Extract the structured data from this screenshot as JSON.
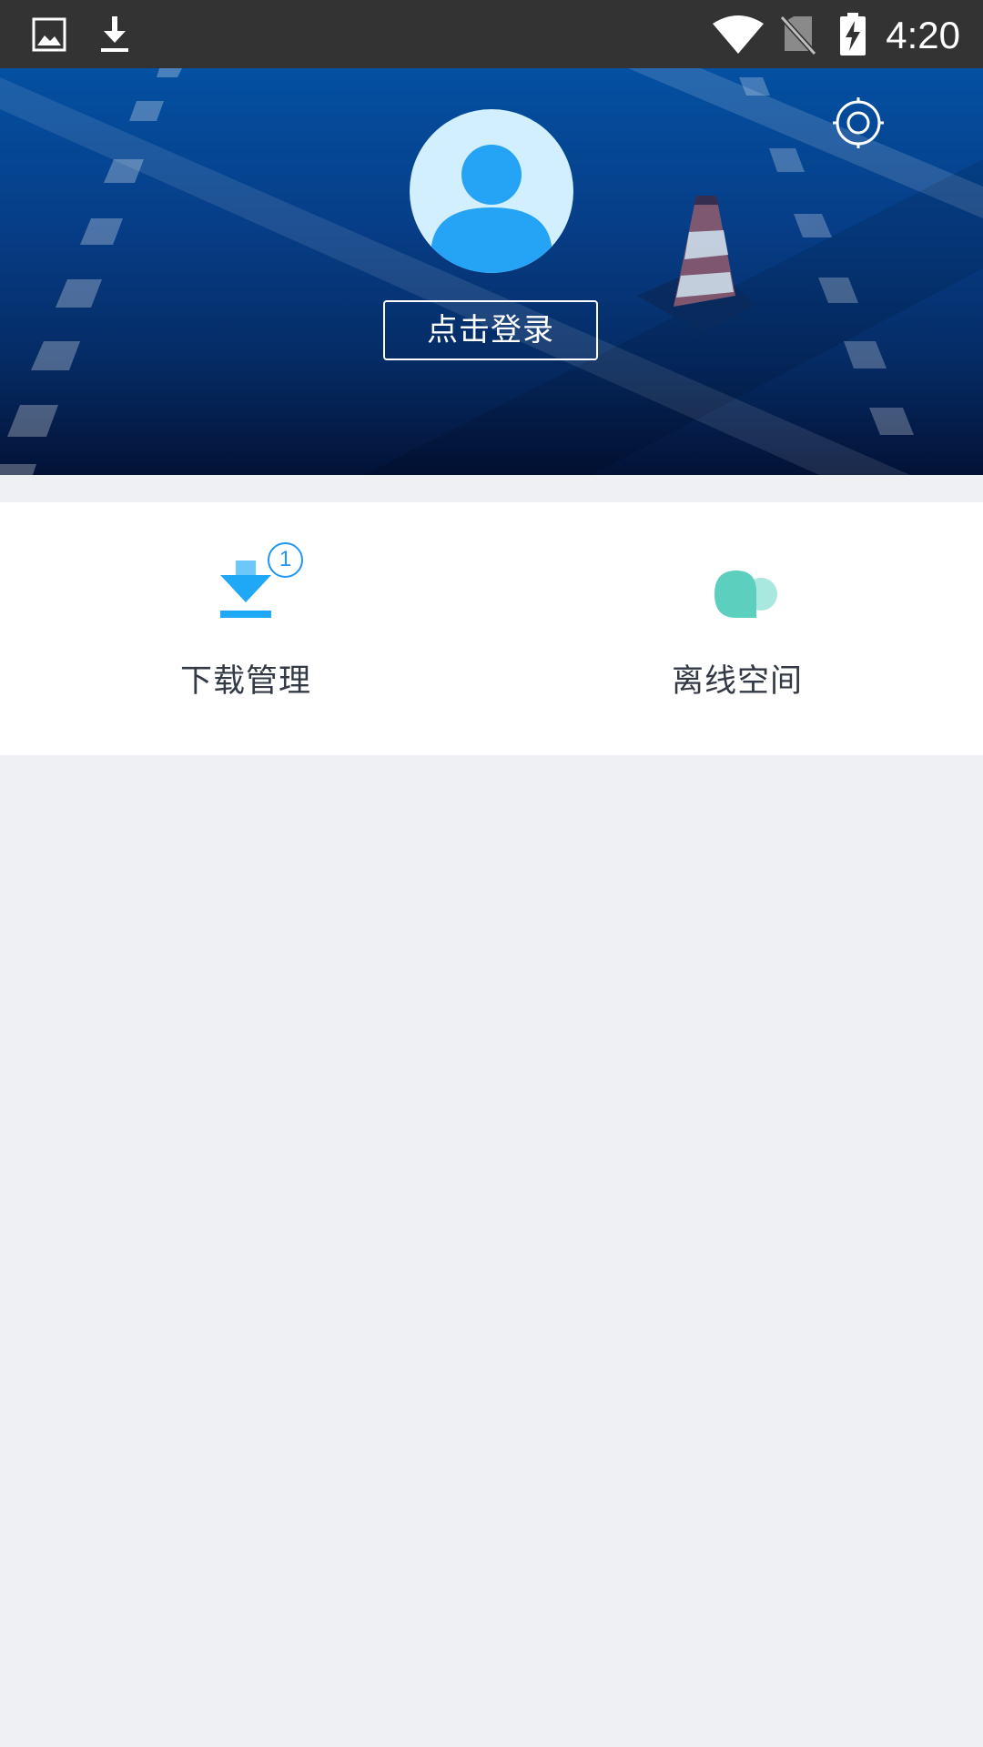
{
  "status_bar": {
    "time": "4:20",
    "left_icons": [
      "image-icon",
      "download-icon"
    ],
    "right_icons": [
      "wifi-icon",
      "no-sim-icon",
      "battery-charging-icon"
    ]
  },
  "header": {
    "login_label": "点击登录",
    "avatar_icon": "user-icon",
    "settings_icon": "settings-icon"
  },
  "menu": {
    "items": [
      {
        "label": "下载管理",
        "icon": "download-icon",
        "badge": "1",
        "color": "#1fa8f5"
      },
      {
        "label": "离线空间",
        "icon": "cloud-icon",
        "color": "#5ccfbe"
      }
    ]
  },
  "colors": {
    "header_top": "#0450a2",
    "header_bottom": "#031236",
    "page_background": "#eff0f3",
    "accent_blue": "#1fa8f5",
    "accent_teal": "#5ccfbe"
  }
}
